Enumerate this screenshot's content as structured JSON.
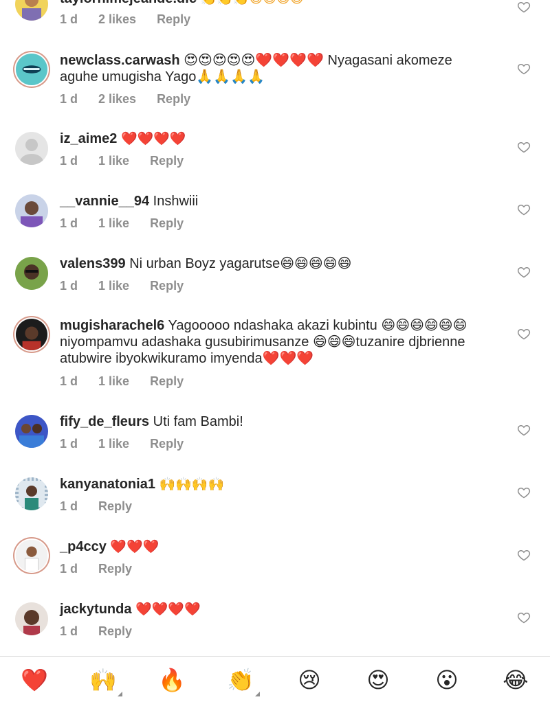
{
  "comments": [
    {
      "username": "taylorhimejeande.dic",
      "text": "👏👏👏😄😄😄😄",
      "time": "1 d",
      "likes": "2 likes",
      "reply": "Reply"
    },
    {
      "username": "newclass.carwash",
      "text": "😍😍😍😍😍❤️❤️❤️❤️ Nyagasani akomeze aguhe umugisha Yago🙏🙏🙏🙏",
      "time": "1 d",
      "likes": "2 likes",
      "reply": "Reply"
    },
    {
      "username": "iz_aime2",
      "text": "❤️❤️❤️❤️",
      "time": "1 d",
      "likes": "1 like",
      "reply": "Reply"
    },
    {
      "username": "__vannie__94",
      "text": "Inshwiii",
      "time": "1 d",
      "likes": "1 like",
      "reply": "Reply"
    },
    {
      "username": "valens399",
      "text": "Ni urban Boyz yagarutse😄😄😄😄😄",
      "time": "1 d",
      "likes": "1 like",
      "reply": "Reply"
    },
    {
      "username": "mugisharachel6",
      "text": "Yagooooo ndashaka akazi kubintu 😄😄😄😄😄😄 niyompamvu adashaka gusubirimusanze 😄😄😄tuzanire djbrienne atubwire ibyokwikuramo imyenda❤️❤️❤️",
      "time": "1 d",
      "likes": "1 like",
      "reply": "Reply"
    },
    {
      "username": "fify_de_fleurs",
      "text": "Uti fam Bambi!",
      "time": "1 d",
      "likes": "1 like",
      "reply": "Reply"
    },
    {
      "username": "kanyanatonia1",
      "text": "🙌🙌🙌🙌",
      "time": "1 d",
      "likes": "",
      "reply": "Reply"
    },
    {
      "username": "_p4ccy",
      "text": "❤️❤️❤️",
      "time": "1 d",
      "likes": "",
      "reply": "Reply"
    },
    {
      "username": "jackytunda",
      "text": "❤️❤️❤️❤️",
      "time": "1 d",
      "likes": "",
      "reply": "Reply"
    }
  ],
  "reactions": [
    "❤️",
    "🙌",
    "🔥",
    "👏",
    "😢",
    "😍",
    "😮",
    "😂"
  ],
  "colors": {
    "text": "#262626",
    "meta": "#8e8e8e",
    "heart": "#e0245e",
    "ring": "#d79a8a"
  }
}
